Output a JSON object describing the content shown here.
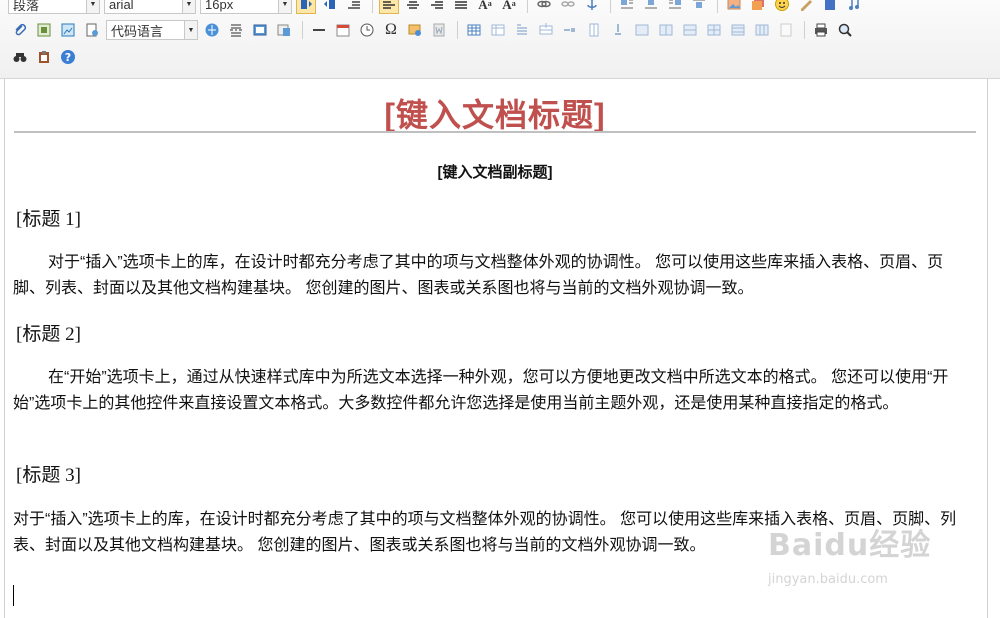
{
  "toolbar": {
    "row1": {
      "paragraph_format": "段落",
      "font_family": "arial",
      "font_size": "16px"
    },
    "row2": {
      "code_language": "代码语言"
    },
    "icons": {
      "row1": [
        "ltr-icon",
        "rtl-icon",
        "indent-icon",
        "align-left-icon",
        "align-center-icon",
        "align-right-icon",
        "align-justify-icon",
        "font-increase-icon",
        "font-decrease-icon",
        "link-icon",
        "unlink-icon",
        "anchor-icon",
        "image-left-icon",
        "image-none-icon",
        "image-right-icon",
        "image-center-icon",
        "insert-image-icon",
        "multi-image-icon",
        "emotion-icon",
        "scrawl-icon",
        "attachment-icon",
        "music-icon"
      ],
      "row2": [
        "attachment-clip-icon",
        "image-icon",
        "insert-frame-icon",
        "template-icon",
        "code-icon",
        "map-icon",
        "page-break-icon",
        "background-icon",
        "wordimage-icon",
        "horizontal-line-icon",
        "date-icon",
        "time-icon",
        "special-char-icon",
        "snap-icon",
        "word-import-icon",
        "insert-table-icon",
        "delete-table-icon",
        "insert-paragraph-before-table-icon",
        "insert-row-icon",
        "delete-row-icon",
        "insert-col-icon",
        "delete-col-icon",
        "merge-cells-icon",
        "merge-right-icon",
        "merge-down-icon",
        "split-to-cells-icon",
        "split-to-rows-icon",
        "split-to-cols-icon",
        "chart-icon",
        "print-icon",
        "preview-icon"
      ],
      "row3": [
        "search-replace-icon",
        "paste-plain-icon",
        "help-icon"
      ]
    }
  },
  "document": {
    "title": "[键入文档标题]",
    "subtitle": "[键入文档副标题]",
    "sections": [
      {
        "heading": "[标题 1]",
        "body": "对于“插入”选项卡上的库，在设计时都充分考虑了其中的项与文档整体外观的协调性。 您可以使用这些库来插入表格、页眉、页脚、列表、封面以及其他文档构建基块。 您创建的图片、图表或关系图也将与当前的文档外观协调一致。"
      },
      {
        "heading": "[标题 2]",
        "body": "在“开始”选项卡上，通过从快速样式库中为所选文本选择一种外观，您可以方便地更改文档中所选文本的格式。 您还可以使用“开始”选项卡上的其他控件来直接设置文本格式。大多数控件都允许您选择是使用当前主题外观，还是使用某种直接指定的格式。"
      },
      {
        "heading": "[标题 3]",
        "body": "对于“插入”选项卡上的库，在设计时都充分考虑了其中的项与文档整体外观的协调性。 您可以使用这些库来插入表格、页眉、页脚、列表、封面以及其他文档构建基块。 您创建的图片、图表或关系图也将与当前的文档外观协调一致。"
      }
    ]
  },
  "watermark": {
    "logo": "Baidu经验",
    "url": "jingyan.baidu.com"
  },
  "colors": {
    "title": "#c0504d",
    "active_button_bg": "#fde7a8",
    "toolbar_bg": "#f3f3f3"
  }
}
